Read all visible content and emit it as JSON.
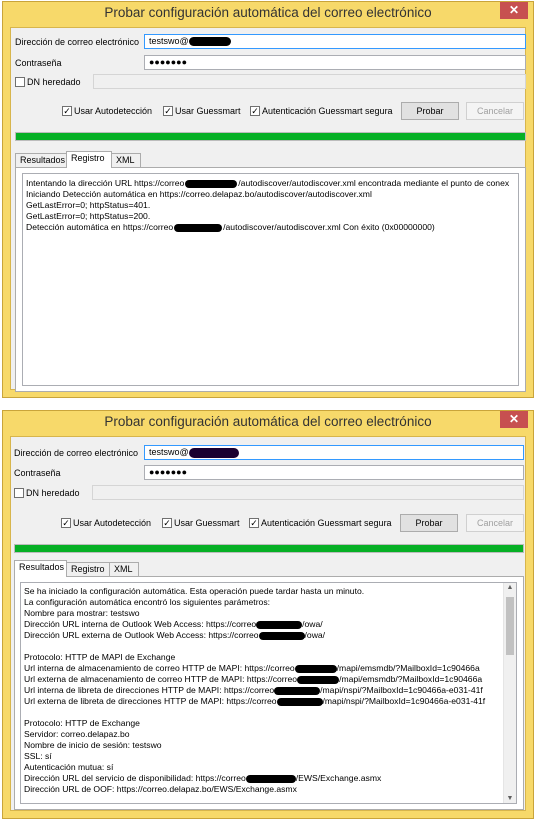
{
  "title": "Probar configuración automática del correo electrónico",
  "close_glyph": "✕",
  "labels": {
    "email": "Dirección de correo electrónico",
    "password": "Contraseña",
    "legacy_dn": "DN heredado"
  },
  "fields": {
    "email_value": "testswo@",
    "password_value": "●●●●●●●"
  },
  "options": {
    "autodetect": "Usar Autodetección",
    "guessmart": "Usar Guessmart",
    "secure_guessmart": "Autenticación Guessmart segura"
  },
  "check_glyph": "✓",
  "buttons": {
    "test": "Probar",
    "cancel": "Cancelar"
  },
  "progress": {
    "value": 1.0,
    "color": "#06b025"
  },
  "tabs": [
    "Resultados",
    "Registro",
    "XML"
  ],
  "log_lines": [
    "Intentando la dirección URL https://correo",
    "/autodiscover/autodiscover.xml encontrada mediante el punto de conex",
    "Iniciando Detección automática en https://correo.delapaz.bo/autodiscover/autodiscover.xml",
    "GetLastError=0; httpStatus=401.",
    "GetLastError=0; httpStatus=200.",
    "Detección automática en https://correo",
    "/autodiscover/autodiscover.xml Con éxito (0x00000000)"
  ],
  "results_lines": [
    "Se ha iniciado la configuración automática. Esta operación puede tardar hasta un minuto.",
    "La configuración automática encontró los siguientes parámetros:",
    "Nombre para mostrar: testswo",
    "Dirección URL interna de Outlook Web Access: https://correo",
    "/owa/",
    "Dirección URL externa de Outlook Web Access: https://correo",
    "/owa/",
    "Protocolo: HTTP de MAPI de Exchange",
    "Url interna de almacenamiento de correo HTTP de MAPI: https://correo",
    "/mapi/emsmdb/?MailboxId=1c90466a",
    "Url externa de almacenamiento de correo HTTP de MAPI: https://correo",
    "/mapi/emsmdb/?MailboxId=1c90466a",
    "Url interna de libreta de direcciones HTTP de MAPI: https://correo",
    "/mapi/nspi/?MailboxId=1c90466a-e031-41f",
    "Url externa de libreta de direcciones HTTP de MAPI: https://correo",
    "/mapi/nspi/?MailboxId=1c90466a-e031-41f",
    "Protocolo: HTTP de Exchange",
    "Servidor: correo.delapaz.bo",
    "Nombre de inicio de sesión: testswo",
    "SSL: sí",
    "Autenticación mutua: sí",
    "Dirección URL del servicio de disponibilidad: https://correo",
    "/EWS/Exchange.asmx",
    "Dirección URL de OOF: https://correo.delapaz.bo/EWS/Exchange.asmx"
  ]
}
